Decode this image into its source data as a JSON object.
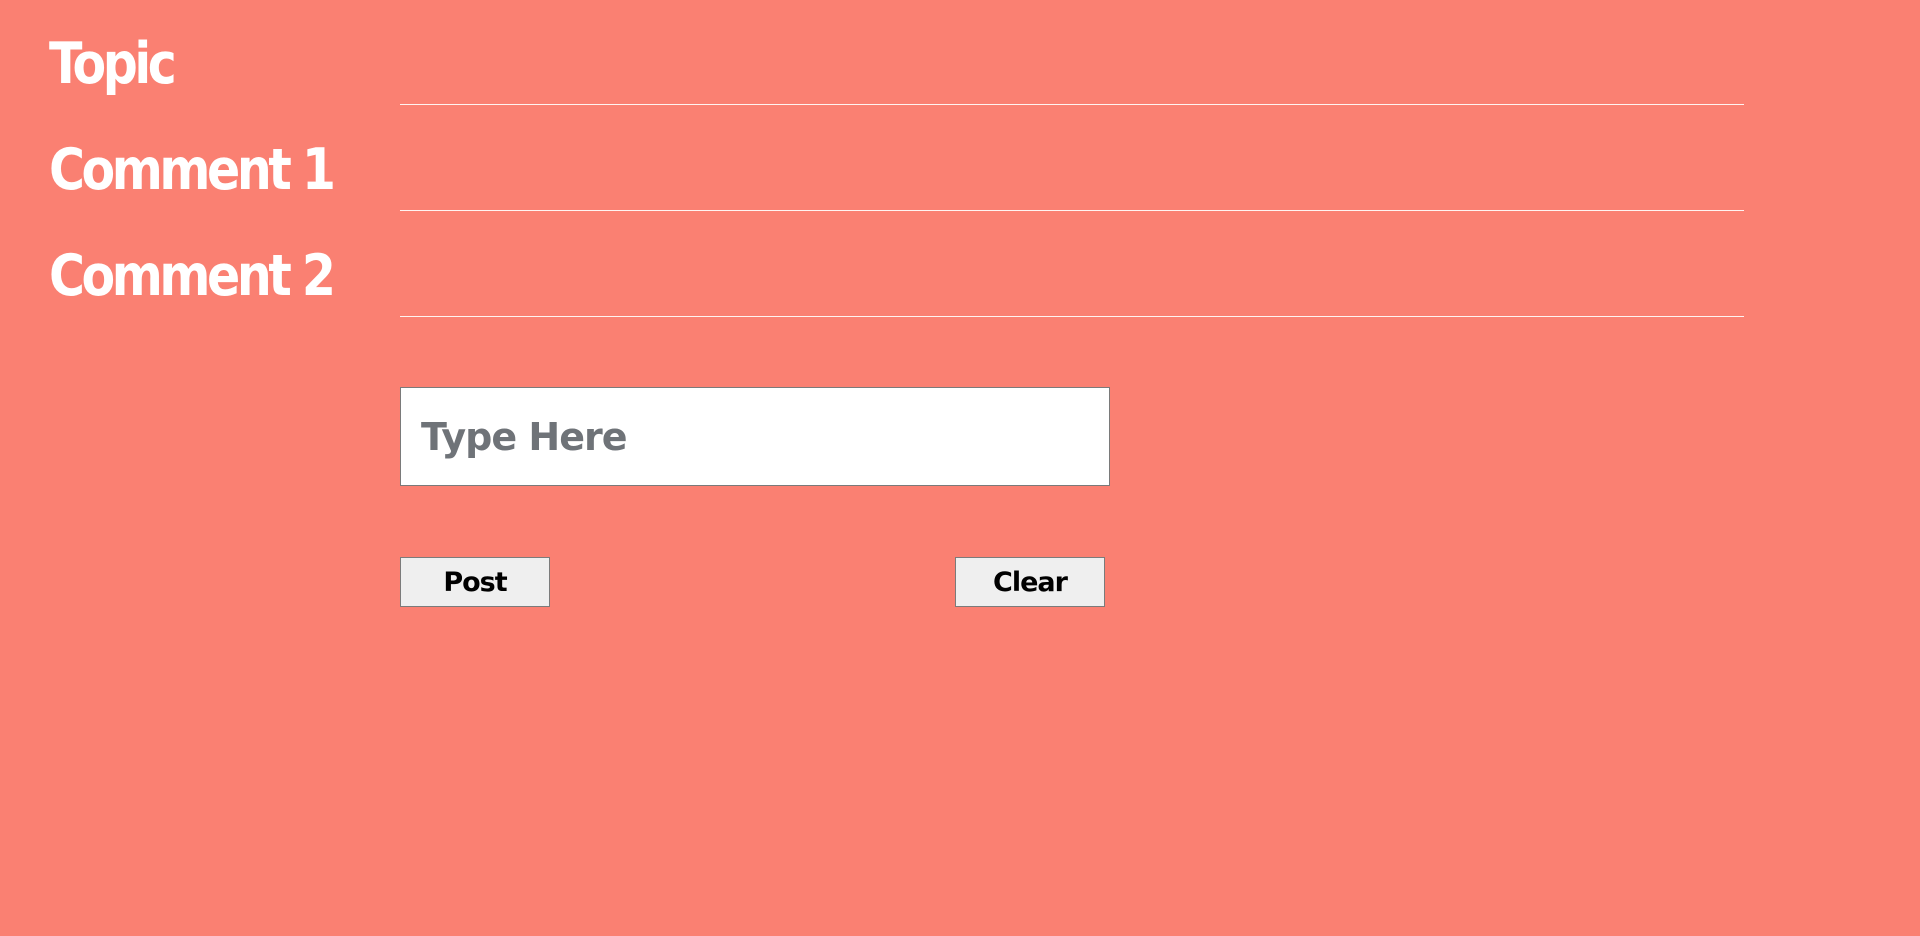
{
  "rows": [
    {
      "label": "Topic"
    },
    {
      "label": "Comment 1"
    },
    {
      "label": "Comment 2"
    }
  ],
  "input": {
    "value": "",
    "placeholder": "Type Here"
  },
  "buttons": {
    "post_label": "Post",
    "clear_label": "Clear"
  },
  "colors": {
    "background": "#fa8072",
    "label_text": "#ffffff",
    "divider": "#ffffff",
    "button_bg": "#efefef",
    "placeholder_text": "#6f7378"
  }
}
